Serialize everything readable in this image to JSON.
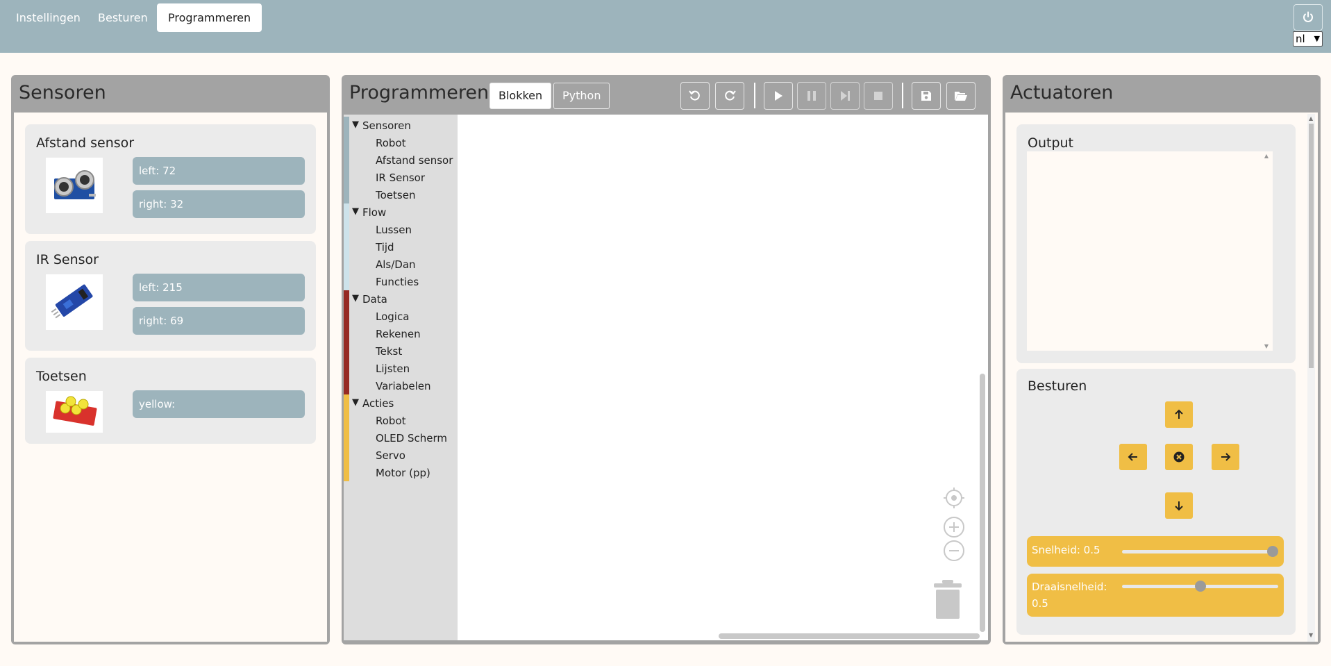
{
  "nav": {
    "tabs": [
      "Instellingen",
      "Besturen",
      "Programmeren"
    ],
    "active": "Programmeren",
    "language": "nl"
  },
  "sensors_panel": {
    "title": "Sensoren",
    "cards": [
      {
        "title": "Afstand sensor",
        "values": [
          "left: 72",
          "right: 32"
        ]
      },
      {
        "title": "IR Sensor",
        "values": [
          "left: 215",
          "right: 69"
        ]
      },
      {
        "title": "Toetsen",
        "values": [
          "yellow:"
        ]
      }
    ]
  },
  "programming_panel": {
    "title": "Programmeren",
    "mode_tabs": [
      "Blokken",
      "Python"
    ],
    "active_mode": "Blokken",
    "toolbar_icons": [
      "undo-icon",
      "redo-icon",
      "play-icon",
      "pause-icon",
      "step-icon",
      "stop-icon",
      "save-icon",
      "open-folder-icon"
    ],
    "toolbox": [
      {
        "category": "Sensoren",
        "color": "#9db4bc",
        "items": [
          "Robot",
          "Afstand sensor",
          "IR Sensor",
          "Toetsen"
        ]
      },
      {
        "category": "Flow",
        "color": "#cde2ea",
        "items": [
          "Lussen",
          "Tijd",
          "Als/Dan",
          "Functies"
        ]
      },
      {
        "category": "Data",
        "color": "#962a24",
        "items": [
          "Logica",
          "Rekenen",
          "Tekst",
          "Lijsten",
          "Variabelen"
        ]
      },
      {
        "category": "Acties",
        "color": "#f0be45",
        "items": [
          "Robot",
          "OLED Scherm",
          "Servo",
          "Motor (pp)"
        ]
      }
    ]
  },
  "actuators_panel": {
    "title": "Actuatoren",
    "output": {
      "title": "Output",
      "text": ""
    },
    "control": {
      "title": "Besturen",
      "speed_label": "Snelheid: 0.5",
      "speed_value": 1.0,
      "turn_label_line1": "Draaisnelheid:",
      "turn_label_line2": "0.5",
      "turn_value": 0.5
    }
  },
  "colors": {
    "accent_blue": "#9db4bc",
    "accent_yellow": "#f0be45",
    "panel_gray": "#a3a3a3",
    "data_red": "#962a24"
  }
}
